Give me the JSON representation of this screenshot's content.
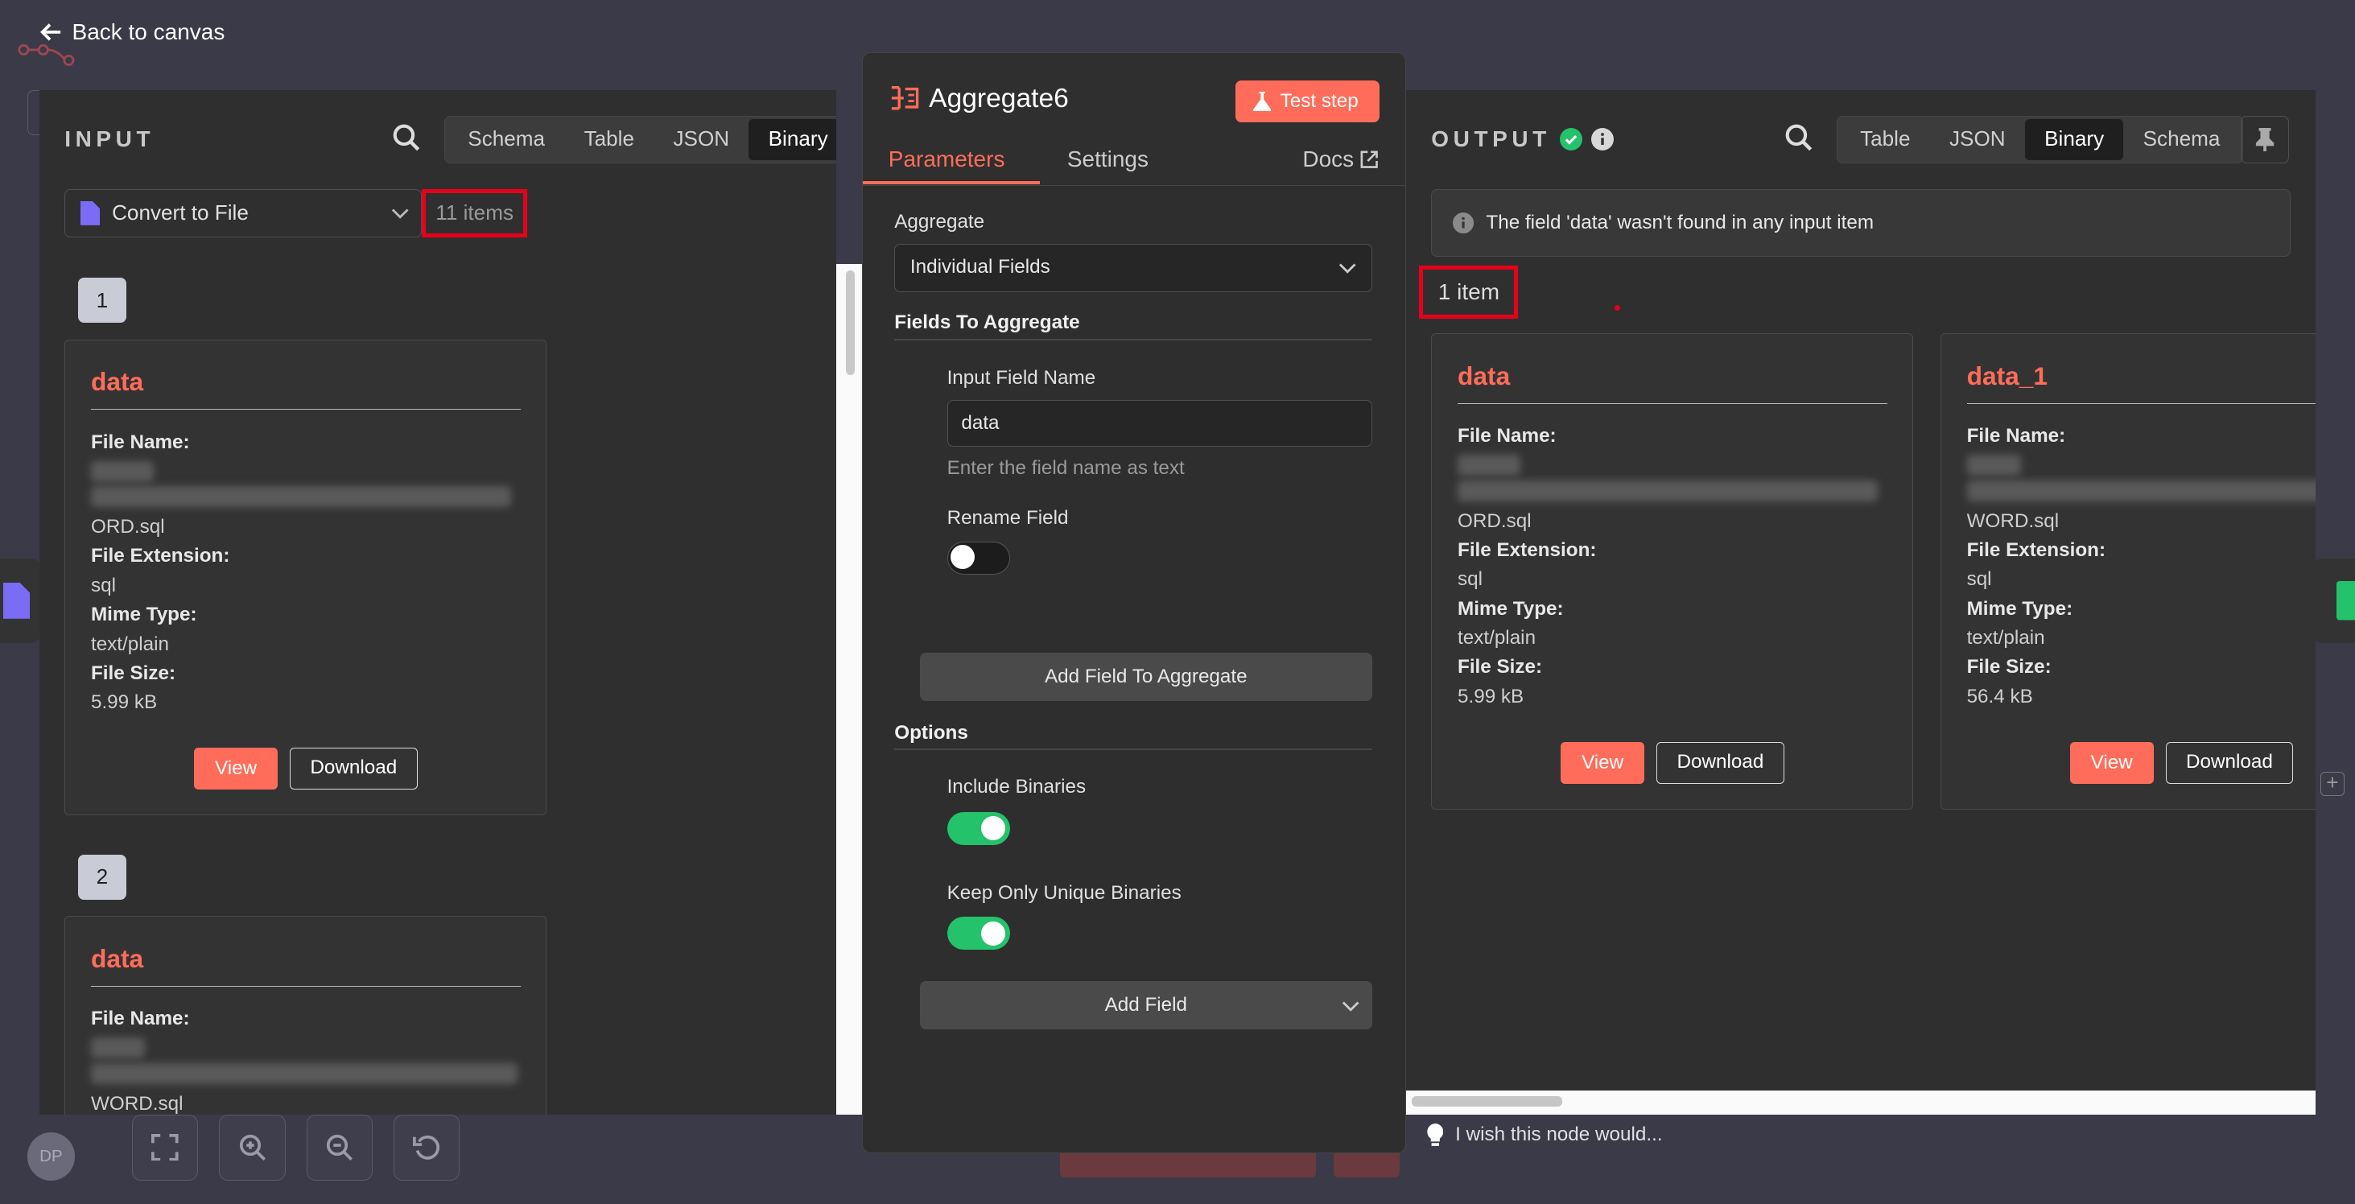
{
  "topbar": {
    "back_label": "Back to canvas"
  },
  "input": {
    "title": "INPUT",
    "tabs": [
      "Schema",
      "Table",
      "JSON",
      "Binary"
    ],
    "active_tab": "Binary",
    "node_select": "Convert to File",
    "items_count": "11 items",
    "cards": [
      {
        "index": "1",
        "name": "data",
        "file_name_label": "File Name:",
        "file_name_tail": "ORD.sql",
        "ext_label": "File Extension:",
        "ext": "sql",
        "mime_label": "Mime Type:",
        "mime": "text/plain",
        "size_label": "File Size:",
        "size": "5.99 kB",
        "view": "View",
        "download": "Download"
      },
      {
        "index": "2",
        "name": "data",
        "file_name_label": "File Name:",
        "file_name_tail": "WORD.sql"
      }
    ]
  },
  "params": {
    "node_name": "Aggregate6",
    "test_step": "Test step",
    "tabs": {
      "parameters": "Parameters",
      "settings": "Settings",
      "docs": "Docs"
    },
    "aggregate_label": "Aggregate",
    "aggregate_value": "Individual Fields",
    "fields_section": "Fields To Aggregate",
    "input_field_label": "Input Field Name",
    "input_field_value": "data",
    "input_field_hint": "Enter the field name as text",
    "rename_label": "Rename Field",
    "rename_on": false,
    "add_field_to_aggregate": "Add Field To Aggregate",
    "options_section": "Options",
    "include_binaries_label": "Include Binaries",
    "include_binaries_on": true,
    "keep_unique_label": "Keep Only Unique Binaries",
    "keep_unique_on": true,
    "add_field": "Add Field"
  },
  "output": {
    "title": "OUTPUT",
    "tabs": [
      "Table",
      "JSON",
      "Binary",
      "Schema"
    ],
    "active_tab": "Binary",
    "notice": "The field 'data' wasn't found in any input item",
    "items_count": "1 item",
    "cards": [
      {
        "name": "data",
        "file_name_label": "File Name:",
        "file_name_tail": "ORD.sql",
        "ext_label": "File Extension:",
        "ext": "sql",
        "mime_label": "Mime Type:",
        "mime": "text/plain",
        "size_label": "File Size:",
        "size": "5.99 kB",
        "view": "View",
        "download": "Download"
      },
      {
        "name": "data_1",
        "file_name_label": "File Name:",
        "file_name_tail": "WORD.sql",
        "ext_label": "File Extension:",
        "ext": "sql",
        "mime_label": "Mime Type:",
        "mime": "text/plain",
        "size_label": "File Size:",
        "size": "56.4 kB",
        "view": "View",
        "download": "Download"
      }
    ]
  },
  "feedback": "I wish this node would...",
  "avatar_initials": "DP",
  "colors": {
    "accent": "#ff6d5a",
    "success": "#24c26b",
    "highlight": "#e6001a"
  }
}
